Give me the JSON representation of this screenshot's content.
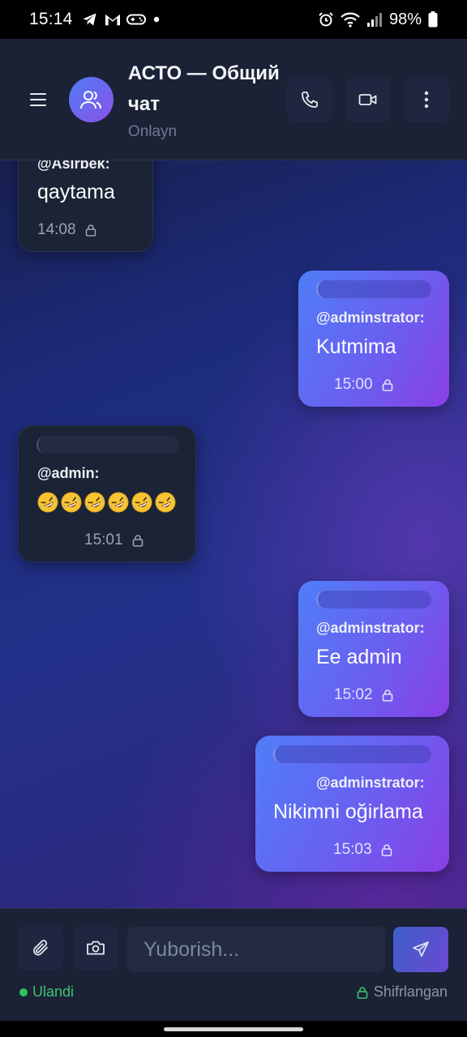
{
  "status_bar": {
    "time": "15:14",
    "battery": "98%",
    "notification_icons": [
      "telegram-icon",
      "gmail-icon",
      "gamepad-icon",
      "dot-icon"
    ],
    "system_icons": [
      "alarm-icon",
      "wifi-icon",
      "signal-icon",
      "battery-icon"
    ]
  },
  "header": {
    "title": "АСТО — Общий чат",
    "status": "Onlayn",
    "menu_icon": "menu-icon",
    "avatar_icon": "users-icon",
    "actions": [
      "phone-icon",
      "video-icon",
      "more-vertical-icon"
    ]
  },
  "messages": [
    {
      "direction": "in",
      "sender": "@Asirbek:",
      "text": "qaytama",
      "time": "14:08"
    },
    {
      "direction": "out",
      "sender": "@adminstrator:",
      "text": "Kutmima",
      "time": "15:00"
    },
    {
      "direction": "in",
      "sender": "@admin:",
      "text": "🤣🤣🤣🤣🤣🤣",
      "emoji_count": 6,
      "time": "15:01"
    },
    {
      "direction": "out",
      "sender": "@adminstrator:",
      "text": "Ee admin",
      "time": "15:02"
    },
    {
      "direction": "out",
      "sender": "@adminstrator:",
      "text": "Nikimni oğirlama",
      "time": "15:03"
    }
  ],
  "composer": {
    "placeholder": "Yuborish...",
    "value": "",
    "connection_status": "Ulandi",
    "encryption_status": "Shifrlangan"
  },
  "colors": {
    "header_bg": "#1b2236",
    "incoming_bubble": "#1b2336",
    "outgoing_gradient_start": "#4f7ef7",
    "outgoing_gradient_end": "#8a3fe6",
    "online_green": "#2fc45f"
  }
}
